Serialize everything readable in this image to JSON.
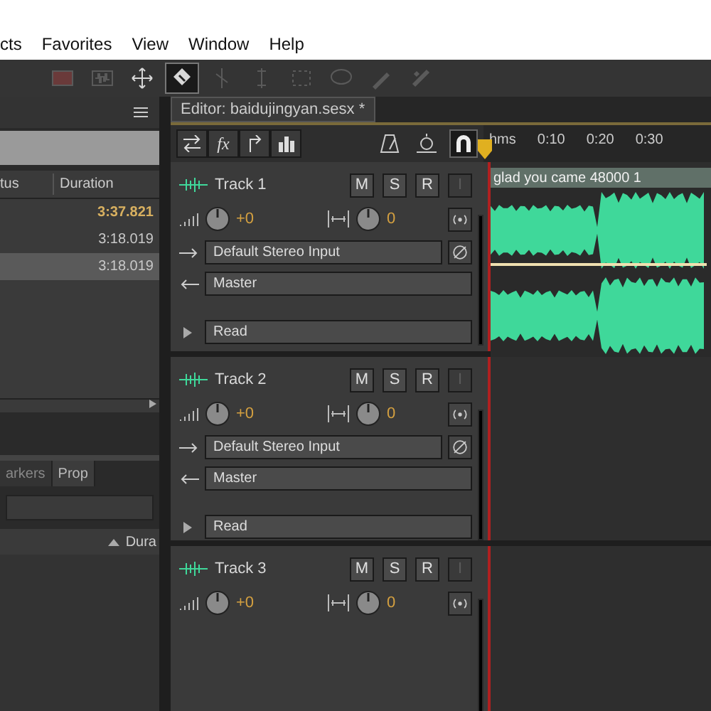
{
  "menu": [
    "cts",
    "Favorites",
    "View",
    "Window",
    "Help"
  ],
  "toolbar": [
    {
      "kind": "dim-red",
      "selected": false
    },
    {
      "kind": "dim-wave",
      "selected": false
    },
    {
      "kind": "move",
      "selected": false
    },
    {
      "kind": "slip",
      "selected": true
    },
    {
      "kind": "dim-razor",
      "selected": false
    },
    {
      "kind": "dim-time",
      "selected": false
    },
    {
      "kind": "dim-marquee",
      "selected": false
    },
    {
      "kind": "dim-lasso",
      "selected": false
    },
    {
      "kind": "dim-brush",
      "selected": false
    },
    {
      "kind": "dim-heal",
      "selected": false
    }
  ],
  "editor_tab": {
    "title": "Editor: baidujingyan.sesx *"
  },
  "files_panel": {
    "columns": [
      "tus",
      "Duration"
    ],
    "rows": [
      {
        "duration": "3:37.821",
        "active": true,
        "selected": false
      },
      {
        "duration": "3:18.019",
        "active": false,
        "selected": false
      },
      {
        "duration": "3:18.019",
        "active": false,
        "selected": true
      }
    ]
  },
  "lower_panel": {
    "tabs": [
      {
        "label": "arkers",
        "selected": false
      },
      {
        "label": "Prop",
        "selected": true
      }
    ],
    "column": "Dura"
  },
  "editor_tools": [
    {
      "kind": "swap",
      "selected": false
    },
    {
      "kind": "fx",
      "label": "fx",
      "selected": false
    },
    {
      "kind": "route",
      "selected": false
    },
    {
      "kind": "eq",
      "selected": false
    }
  ],
  "timeline_tools": [
    {
      "kind": "metronome",
      "selected": false
    },
    {
      "kind": "stopwatch",
      "selected": false
    },
    {
      "kind": "magnet",
      "selected": true
    }
  ],
  "ruler": [
    "hms",
    "0:10",
    "0:20",
    "0:30"
  ],
  "tracks": [
    {
      "name": "Track 1",
      "buttons": [
        {
          "label": "M",
          "disabled": false
        },
        {
          "label": "S",
          "disabled": false
        },
        {
          "label": "R",
          "disabled": false
        },
        {
          "label": "I",
          "disabled": true
        }
      ],
      "volume": "+0",
      "pan": "0",
      "input": "Default Stereo Input",
      "output": "Master",
      "automation": "Read",
      "clip": {
        "title": "glad you came 48000 1"
      }
    },
    {
      "name": "Track 2",
      "buttons": [
        {
          "label": "M",
          "disabled": false
        },
        {
          "label": "S",
          "disabled": false
        },
        {
          "label": "R",
          "disabled": false
        },
        {
          "label": "I",
          "disabled": true
        }
      ],
      "volume": "+0",
      "pan": "0",
      "input": "Default Stereo Input",
      "output": "Master",
      "automation": "Read"
    },
    {
      "name": "Track 3",
      "buttons": [
        {
          "label": "M",
          "disabled": false
        },
        {
          "label": "S",
          "disabled": false
        },
        {
          "label": "R",
          "disabled": false
        },
        {
          "label": "I",
          "disabled": true
        }
      ],
      "volume": "+0",
      "pan": "0"
    }
  ]
}
